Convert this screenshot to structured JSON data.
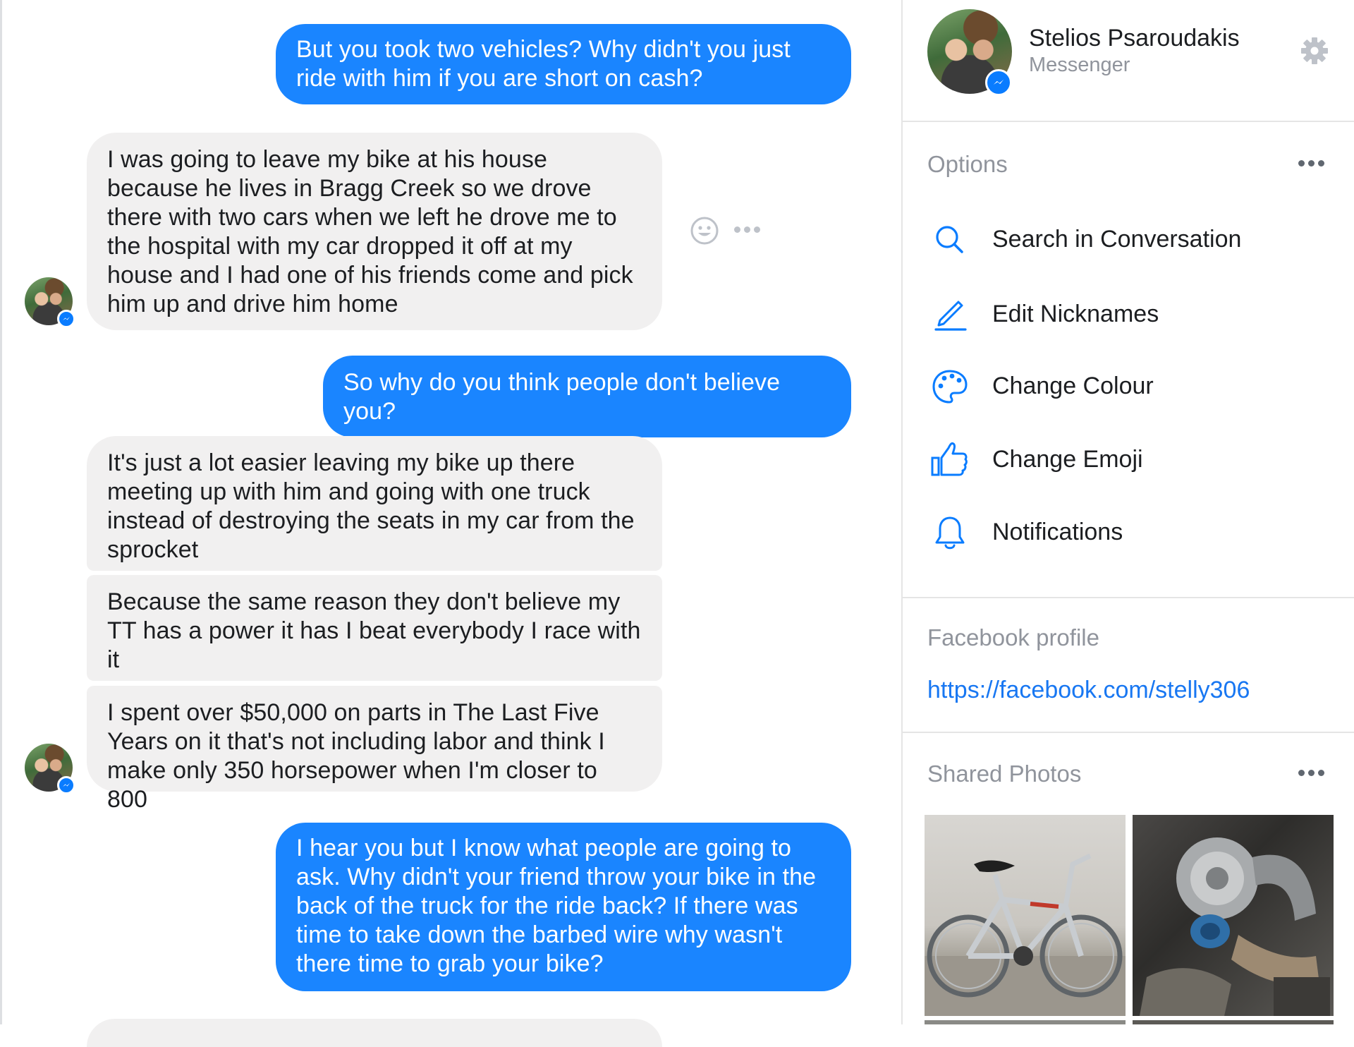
{
  "conversation": {
    "messages": [
      {
        "from": "me",
        "text": "But you took two vehicles? Why didn't you just ride with him if you are short on cash?"
      },
      {
        "from": "them",
        "text": "I was going to leave my bike at his house because he lives in Bragg Creek so we drove there with two cars when we left he drove me to the hospital with my car dropped it off at my house and I had one of his friends come and pick him up and drive him home"
      },
      {
        "from": "me",
        "text": "So why do you think people don't believe you?"
      },
      {
        "from": "them",
        "text": "It's just a lot easier leaving my bike up there meeting up with him and going with one truck instead of destroying the seats in my car from the sprocket"
      },
      {
        "from": "them",
        "text": "Because the same reason they don't believe my TT has a power it has I beat everybody I race with it"
      },
      {
        "from": "them",
        "text": "I spent over $50,000 on parts in The Last Five Years on it that's not including labor and think I make only 350 horsepower when I'm closer to 800"
      },
      {
        "from": "me",
        "text": "I hear you but I know what people are going to ask. Why didn't your friend throw your bike in the back of the truck for the ride back? If there was time to take down the barbed wire why wasn't there time to grab your bike?"
      }
    ],
    "hover_actions": {
      "react_icon": "smiley-icon",
      "more_icon": "more-dots-icon"
    }
  },
  "profile": {
    "name": "Stelios Psaroudakis",
    "subtitle": "Messenger",
    "settings_icon": "gear-icon"
  },
  "options": {
    "label": "Options",
    "items": [
      {
        "label": "Search in Conversation",
        "icon": "search-icon"
      },
      {
        "label": "Edit Nicknames",
        "icon": "pencil-icon"
      },
      {
        "label": "Change Colour",
        "icon": "palette-icon"
      },
      {
        "label": "Change Emoji",
        "icon": "thumbs-up-icon"
      },
      {
        "label": "Notifications",
        "icon": "bell-icon"
      }
    ]
  },
  "facebook_profile": {
    "label": "Facebook profile",
    "link": "https://facebook.com/stelly306"
  },
  "shared_photos": {
    "label": "Shared Photos",
    "photos": [
      "bicycle-photo",
      "turbo-engine-photo"
    ]
  },
  "colors": {
    "accent": "#0084ff",
    "outgoing_bubble": "#1a85ff",
    "incoming_bubble": "#f1f0f0",
    "muted_text": "#90949c",
    "link": "#1877f2"
  }
}
